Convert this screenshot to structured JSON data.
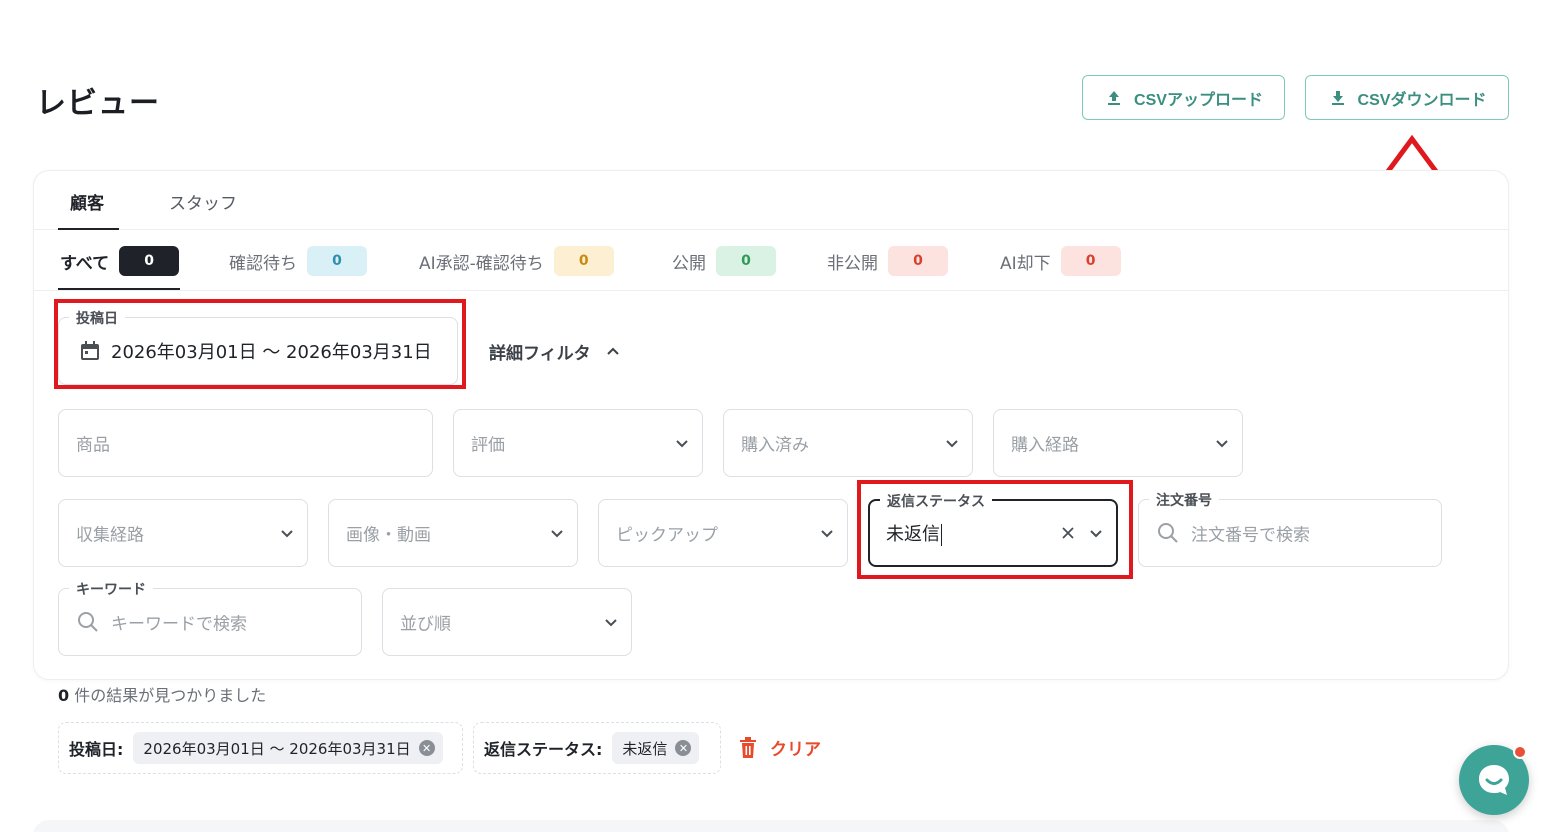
{
  "page": {
    "title": "レビュー"
  },
  "header": {
    "csv_upload_label": "CSVアップロード",
    "csv_download_label": "CSVダウンロード"
  },
  "tabs": [
    {
      "label": "顧客",
      "active": true
    },
    {
      "label": "スタッフ",
      "active": false
    }
  ],
  "status_filters": [
    {
      "label": "すべて",
      "count": "0",
      "badge_bg": "#1f2329",
      "badge_fg": "#ffffff",
      "active": true
    },
    {
      "label": "確認待ち",
      "count": "0",
      "badge_bg": "#d9f0f7",
      "badge_fg": "#2e8fb0"
    },
    {
      "label": "AI承認-確認待ち",
      "count": "0",
      "badge_bg": "#fdf0d2",
      "badge_fg": "#c98a12"
    },
    {
      "label": "公開",
      "count": "0",
      "badge_bg": "#d9f2e3",
      "badge_fg": "#2f9a5a"
    },
    {
      "label": "非公開",
      "count": "0",
      "badge_bg": "#fde3e0",
      "badge_fg": "#d8402f"
    },
    {
      "label": "AI却下",
      "count": "0",
      "badge_bg": "#fde3e0",
      "badge_fg": "#d8402f"
    }
  ],
  "date_filter": {
    "label": "投稿日",
    "value": "2026年03月01日 〜 2026年03月31日"
  },
  "detail_filter_label": "詳細フィルタ",
  "filters": {
    "product": "商品",
    "rating": "評価",
    "purchased": "購入済み",
    "purchase_channel": "購入経路",
    "collection_channel": "収集経路",
    "media": "画像・動画",
    "pickup": "ピックアップ",
    "reply_status": {
      "label": "返信ステータス",
      "value": "未返信"
    },
    "order_number": {
      "label": "注文番号",
      "placeholder": "注文番号で検索"
    },
    "keyword": {
      "label": "キーワード",
      "placeholder": "キーワードで検索"
    },
    "sort": "並び順"
  },
  "results": {
    "count": "0",
    "text": " 件の結果が見つかりました"
  },
  "active_chips": [
    {
      "title": "投稿日:",
      "value": "2026年03月01日 〜 2026年03月31日"
    },
    {
      "title": "返信ステータス:",
      "value": "未返信"
    }
  ],
  "clear_label": "クリア",
  "colors": {
    "accent": "#3ea497",
    "annotation": "#e0191e",
    "danger": "#e84a2c"
  }
}
